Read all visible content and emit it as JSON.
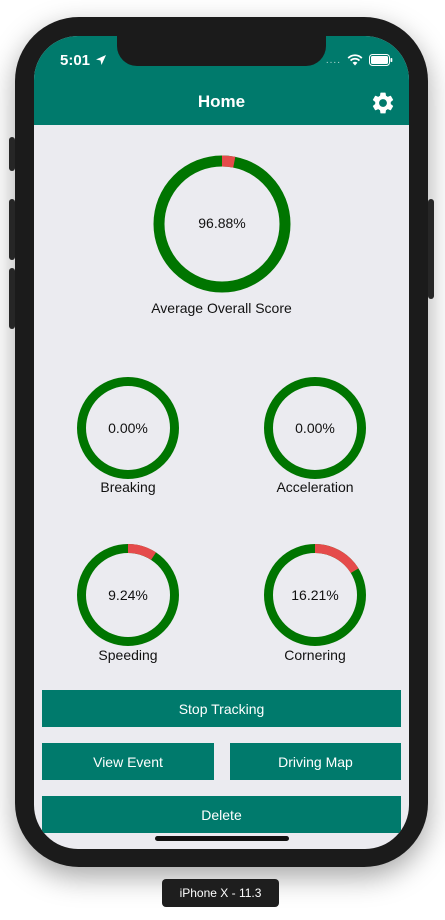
{
  "status_bar": {
    "time": "5:01",
    "signal_dots": "....",
    "location_icon": "location-arrow-icon",
    "wifi_icon": "wifi-icon",
    "battery_icon": "battery-icon"
  },
  "nav": {
    "title": "Home",
    "settings_icon": "gear-icon"
  },
  "colors": {
    "brand": "#007a6c",
    "gauge_ok": "#007500",
    "gauge_bad": "#e54b4b",
    "background": "#ebebf0"
  },
  "overall": {
    "value_text": "96.88%",
    "value": 96.88,
    "label": "Average Overall Score"
  },
  "scores": [
    {
      "key": "breaking",
      "value_text": "0.00%",
      "value": 0.0,
      "label": "Breaking"
    },
    {
      "key": "acceleration",
      "value_text": "0.00%",
      "value": 0.0,
      "label": "Acceleration"
    },
    {
      "key": "speeding",
      "value_text": "9.24%",
      "value": 9.24,
      "label": "Speeding"
    },
    {
      "key": "cornering",
      "value_text": "16.21%",
      "value": 16.21,
      "label": "Cornering"
    }
  ],
  "buttons": {
    "stop_tracking": "Stop Tracking",
    "view_event": "View Event",
    "driving_map": "Driving Map",
    "delete": "Delete"
  },
  "device_label": "iPhone X - 11.3"
}
